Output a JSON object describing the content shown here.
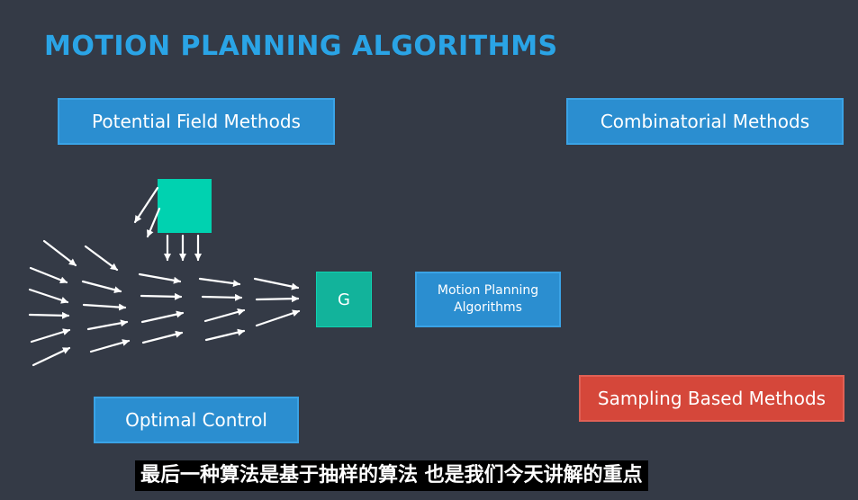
{
  "slide": {
    "title": "MOTION PLANNING ALGORITHMS",
    "boxes": {
      "potential": "Potential Field Methods",
      "combinatorial": "Combinatorial Methods",
      "motion": "Motion Planning Algorithms",
      "optimal": "Optimal Control",
      "sampling": "Sampling Based Methods"
    },
    "goal_label": "G",
    "subtitle": "最后一种算法是基于抽样的算法 也是我们今天讲解的重点"
  },
  "colors": {
    "background": "#343a46",
    "title": "#2aa4e6",
    "box_blue": "#2b8ed0",
    "box_red": "#d5473a",
    "teal": "#00d2b0",
    "goal": "#12b39b",
    "arrow": "#ffffff"
  }
}
